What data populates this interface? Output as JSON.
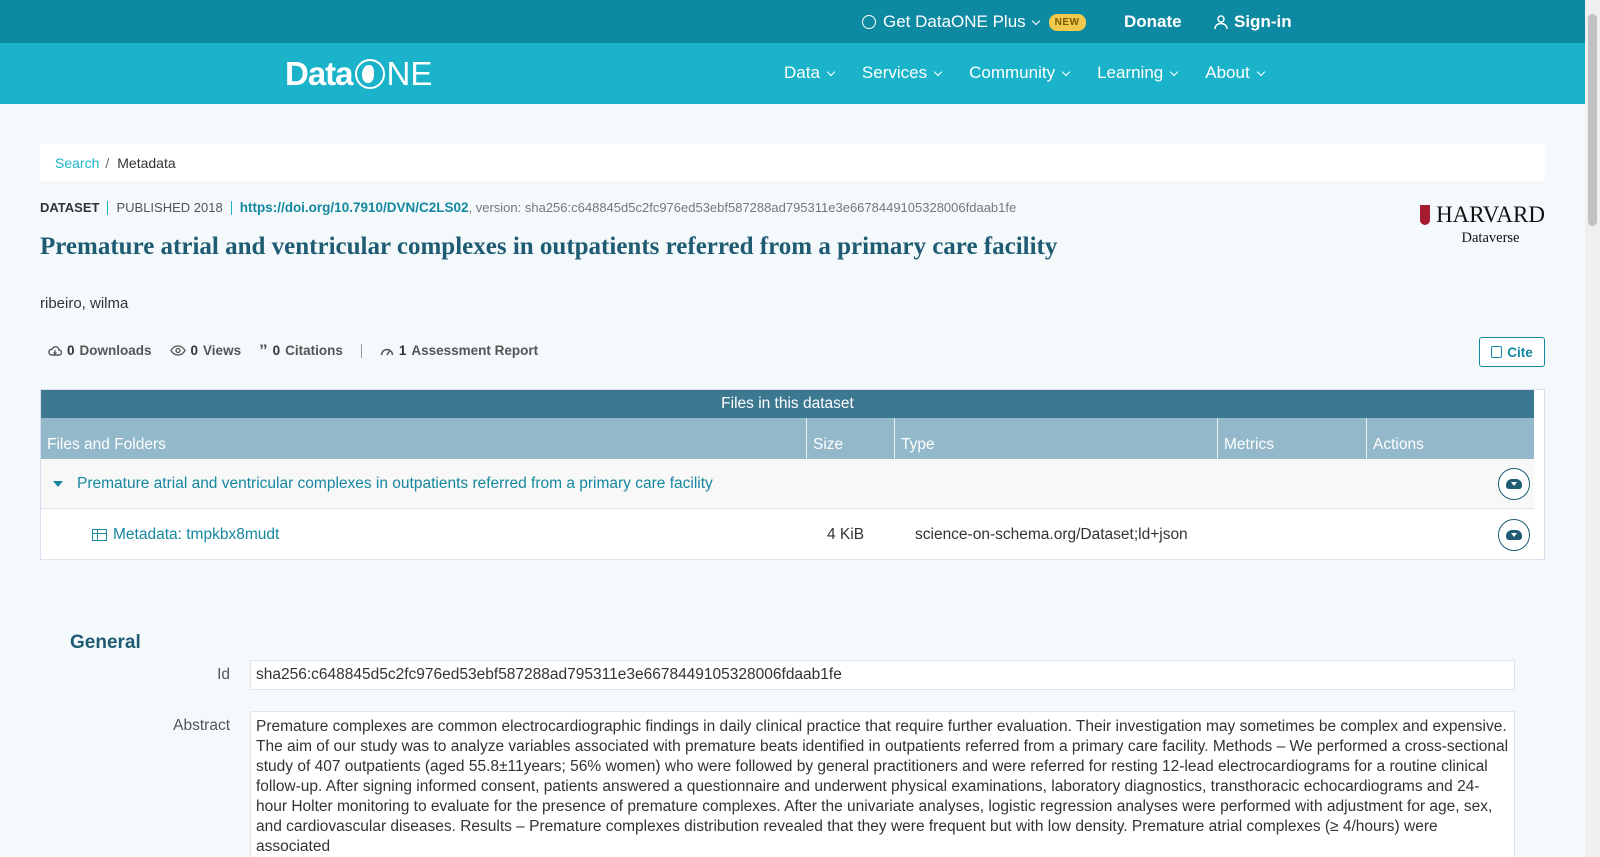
{
  "topbar": {
    "plus_label": "Get DataONE Plus",
    "plus_badge": "NEW",
    "donate": "Donate",
    "signin": "Sign-in"
  },
  "logo": {
    "part1": "Data",
    "part2": "NE"
  },
  "nav": [
    "Data",
    "Services",
    "Community",
    "Learning",
    "About"
  ],
  "breadcrumb": {
    "search": "Search",
    "sep": "/",
    "current": "Metadata"
  },
  "dataset": {
    "kind": "DATASET",
    "published": "PUBLISHED 2018",
    "doi": "https://doi.org/10.7910/DVN/C2LS02",
    "version": ", version: sha256:c648845d5c2fc976ed53ebf587288ad795311e3e6678449105328006fdaab1fe",
    "title": "Premature atrial and ventricular complexes in outpatients referred from a primary care facility",
    "author": "ribeiro, wilma"
  },
  "harvard": {
    "line1": "HARVARD",
    "line2": "Dataverse"
  },
  "metrics": {
    "downloads_count": "0",
    "downloads_label": "Downloads",
    "views_count": "0",
    "views_label": "Views",
    "citations_count": "0",
    "citations_label": "Citations",
    "assessment_count": "1",
    "assessment_label": "Assessment Report"
  },
  "cite": "Cite",
  "files": {
    "heading": "Files in this dataset",
    "columns": [
      "Files and Folders",
      "Size",
      "Type",
      "Metrics",
      "Actions"
    ],
    "folder": "Premature atrial and ventricular complexes in outpatients referred from a primary care facility",
    "file_name": "Metadata: tmpkbx8mudt",
    "file_size": "4 KiB",
    "file_type": "science-on-schema.org/Dataset;ld+json"
  },
  "general": {
    "heading": "General",
    "id_label": "Id",
    "id_value": "sha256:c648845d5c2fc976ed53ebf587288ad795311e3e6678449105328006fdaab1fe",
    "abstract_label": "Abstract",
    "abstract_value": "Premature complexes are common electrocardiographic findings in daily clinical practice that require further evaluation. Their investigation may sometimes be complex and expensive. The aim of our study was to analyze variables associated with premature beats identified in outpatients referred from a primary care facility. Methods – We performed a cross-sectional study of 407 outpatients (aged 55.8±11years; 56% women) who were followed by general practitioners and were referred for resting 12-lead electrocardiograms for a routine clinical follow-up. After signing informed consent, patients answered a questionnaire and underwent physical examinations, laboratory diagnostics, transthoracic echocardiograms and 24-hour Holter monitoring to evaluate for the presence of premature complexes. After the univariate analyses, logistic regression analyses were performed with adjustment for age, sex, and cardiovascular diseases. Results – Premature complexes distribution revealed that they were frequent but with low density. Premature atrial complexes (≥ 4/hours) were associated"
  }
}
